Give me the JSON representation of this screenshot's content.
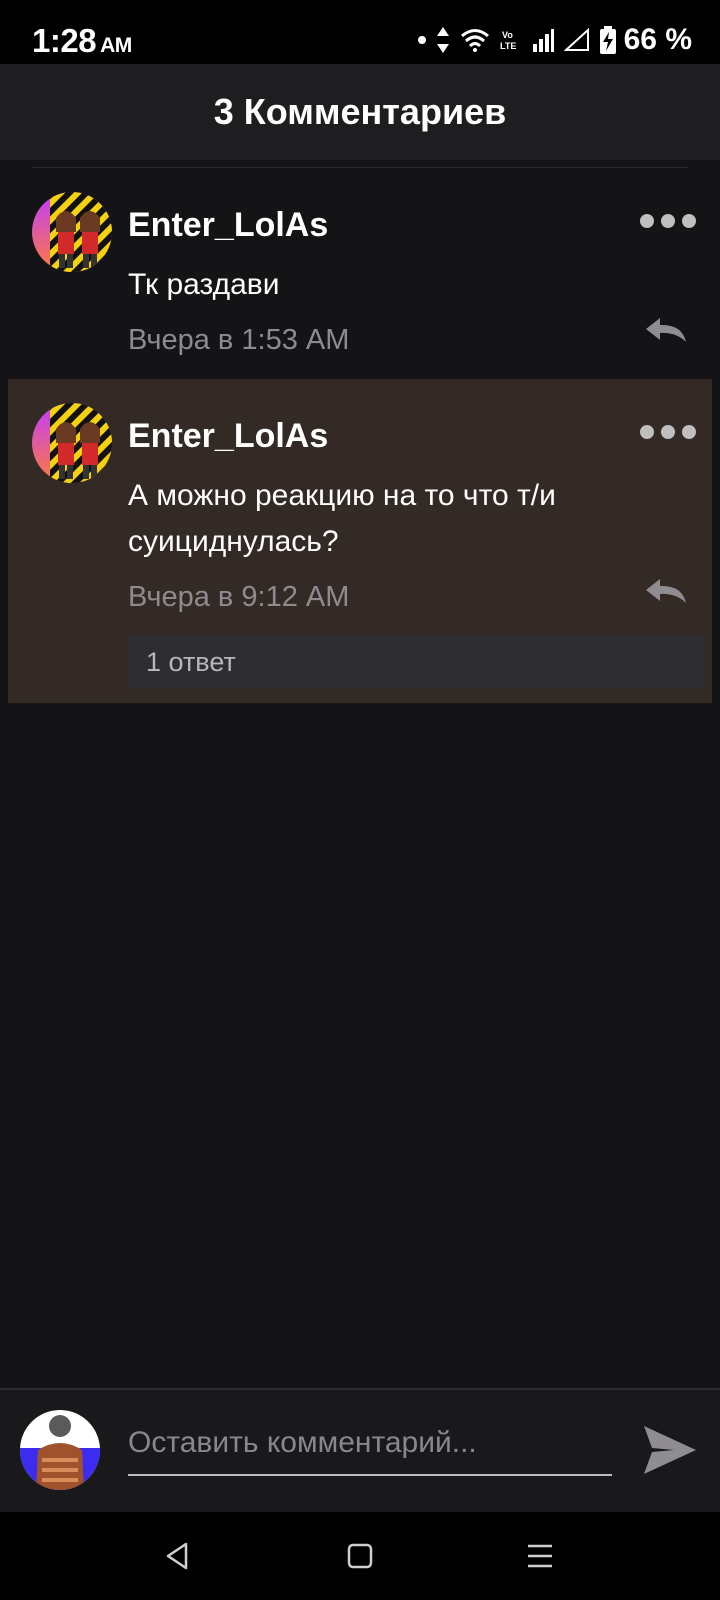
{
  "status_bar": {
    "time": "1:28",
    "ampm": "AM",
    "battery_percent": "66 %",
    "icons": [
      "notification-dot-icon",
      "data-arrows-icon",
      "wifi-icon",
      "volte-icon",
      "signal-bars-icon",
      "signal-outline-icon",
      "battery-charging-icon"
    ]
  },
  "header": {
    "title": "3 Комментариев"
  },
  "comments": [
    {
      "username": "Enter_LolAs",
      "text": "Тк раздави",
      "timestamp": "Вчера в 1:53 AM",
      "highlighted": false
    },
    {
      "username": "Enter_LolAs",
      "text": "А можно реакцию на то что т/и суициднулась?",
      "timestamp": "Вчера в 9:12 AM",
      "replies_label": "1 ответ",
      "highlighted": true
    }
  ],
  "composer": {
    "placeholder": "Оставить комментарий..."
  },
  "nav_bar": {
    "icons": [
      "back-icon",
      "home-icon",
      "menu-icon"
    ]
  },
  "colors": {
    "background": "#141316",
    "header_bg": "#1e1d20",
    "highlight_bg": "#332a25",
    "muted_text": "#8e8b90"
  }
}
